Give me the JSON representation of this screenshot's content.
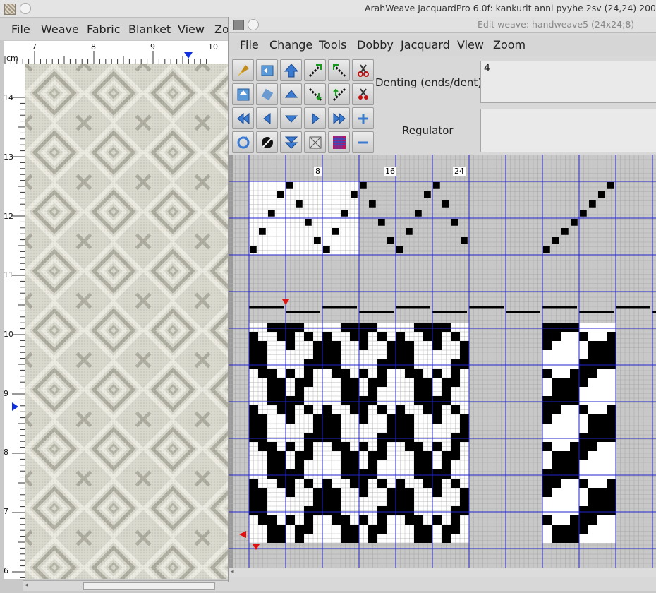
{
  "main_window": {
    "title": "ArahWeave JacquardPro 6.0f: kankurit anni pyyhe 2sv (24,24) 200",
    "menu": [
      "File",
      "Weave",
      "Fabric",
      "Blanket",
      "View",
      "Zo"
    ]
  },
  "ruler": {
    "unit": "cm",
    "top_labels": [
      "7",
      "8",
      "9",
      "10"
    ],
    "left_labels": [
      "14",
      "13",
      "12",
      "11",
      "10",
      "9",
      "8",
      "7",
      "6"
    ]
  },
  "edit_window": {
    "title": "Edit weave: handweave5 (24x24;8)",
    "menu": [
      "File",
      "Change",
      "Tools",
      "Dobby",
      "Jacquard",
      "View",
      "Zoom"
    ],
    "denting_label": "Denting (ends/dent)",
    "denting_value": "4",
    "regulator_label": "Regulator",
    "regulator_value": ""
  },
  "toolbar_icons": [
    "brush-icon",
    "undo-icon",
    "shift-up-icon",
    "diagonal-right-icon",
    "diagonal-left-up-icon",
    "scissors-icon",
    "mirror-vertical-icon",
    "rotate-icon",
    "triangle-up-icon",
    "diagonal-down-icon",
    "diagonal-up-icon",
    "cut-color-icon",
    "double-left-icon",
    "left-icon",
    "down-icon",
    "right-icon",
    "double-right-icon",
    "plus-icon",
    "refresh-icon",
    "invert-icon",
    "double-down-icon",
    "clear-icon",
    "color-grid-icon",
    "minus-icon"
  ],
  "draft": {
    "column_labels": [
      "8",
      "16",
      "24"
    ],
    "ends": 24,
    "picks": 24,
    "shafts": 8
  },
  "colors": {
    "blue_grid": "#2222cc",
    "marker_red": "#e01010",
    "marker_blue": "#1030e0",
    "fabric_light": "#e6e5da",
    "fabric_dark": "#a9a89a"
  }
}
